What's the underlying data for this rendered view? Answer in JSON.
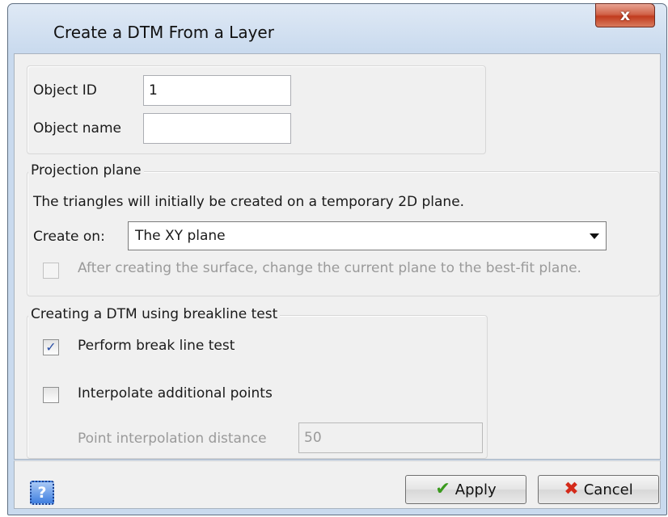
{
  "window": {
    "title": "Create a DTM From a Layer",
    "close_label": "x"
  },
  "object": {
    "id_label": "Object ID",
    "id_value": "1",
    "name_label": "Object name",
    "name_value": ""
  },
  "projection": {
    "legend": "Projection plane",
    "description": "The triangles will initially be created on a temporary 2D plane.",
    "create_on_label": "Create on:",
    "create_on_value": "The XY plane",
    "bestfit_label": "After creating the surface, change the current plane to the best-fit plane.",
    "bestfit_checked": false,
    "bestfit_enabled": false
  },
  "breakline": {
    "legend": "Creating a DTM using breakline test",
    "perform_label": "Perform break line test",
    "perform_checked": true,
    "interpolate_label": "Interpolate additional points",
    "interpolate_checked": false,
    "distance_label": "Point interpolation distance",
    "distance_value": "50"
  },
  "footer": {
    "help_label": "?",
    "apply_label": "Apply",
    "cancel_label": "Cancel"
  },
  "icons": {
    "help": "help-icon",
    "apply": "checkmark-icon",
    "cancel": "x-mark-icon"
  },
  "colors": {
    "apply_check": "#3a9a1e",
    "cancel_x": "#d42a1a",
    "close_button": "#c4472a",
    "help_button": "#3f7fe0"
  }
}
